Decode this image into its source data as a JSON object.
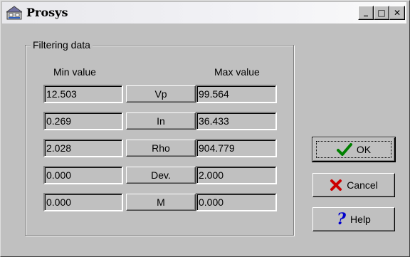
{
  "window": {
    "title": "Prosys",
    "app_icon": "prosys-app-icon",
    "controls": {
      "minimize": "_",
      "maximize": "□",
      "close": "✕"
    }
  },
  "group": {
    "title": "Filtering data",
    "min_header": "Min value",
    "max_header": "Max value",
    "rows": [
      {
        "min": "12.503",
        "param": "Vp",
        "max": "99.564"
      },
      {
        "min": "0.269",
        "param": "In",
        "max": "36.433"
      },
      {
        "min": "2.028",
        "param": "Rho",
        "max": "904.779"
      },
      {
        "min": "0.000",
        "param": "Dev.",
        "max": "2.000"
      },
      {
        "min": "0.000",
        "param": "M",
        "max": "0.000"
      }
    ]
  },
  "buttons": {
    "ok": {
      "label": "OK",
      "icon": "green-check-icon"
    },
    "cancel": {
      "label": "Cancel",
      "icon": "red-x-icon"
    },
    "help": {
      "label": "Help",
      "icon": "blue-question-icon"
    }
  },
  "colors": {
    "face": "#c0c0c0",
    "check": "#008000",
    "cancel_x": "#cc0000",
    "help_q": "#0000cc"
  }
}
